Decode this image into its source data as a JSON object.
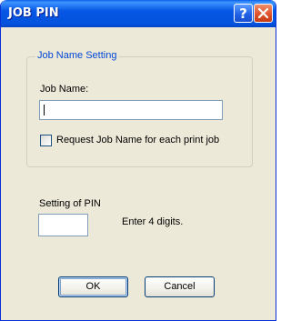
{
  "window": {
    "title": "JOB PIN"
  },
  "titlebar_buttons": {
    "help_icon": "question-mark",
    "close_icon": "x-mark"
  },
  "job_name_group": {
    "legend": "Job Name Setting",
    "job_name_label": "Job Name:",
    "job_name_value": "",
    "request_checkbox_label": "Request Job Name for each print job",
    "request_checkbox_checked": false
  },
  "pin": {
    "label": "Setting of PIN",
    "value": "",
    "hint": "Enter 4 digits."
  },
  "buttons": {
    "ok": "OK",
    "cancel": "Cancel"
  },
  "colors": {
    "titlebar": "#0453de",
    "legend_text": "#0046d5",
    "dialog_face": "#ece9d8"
  }
}
